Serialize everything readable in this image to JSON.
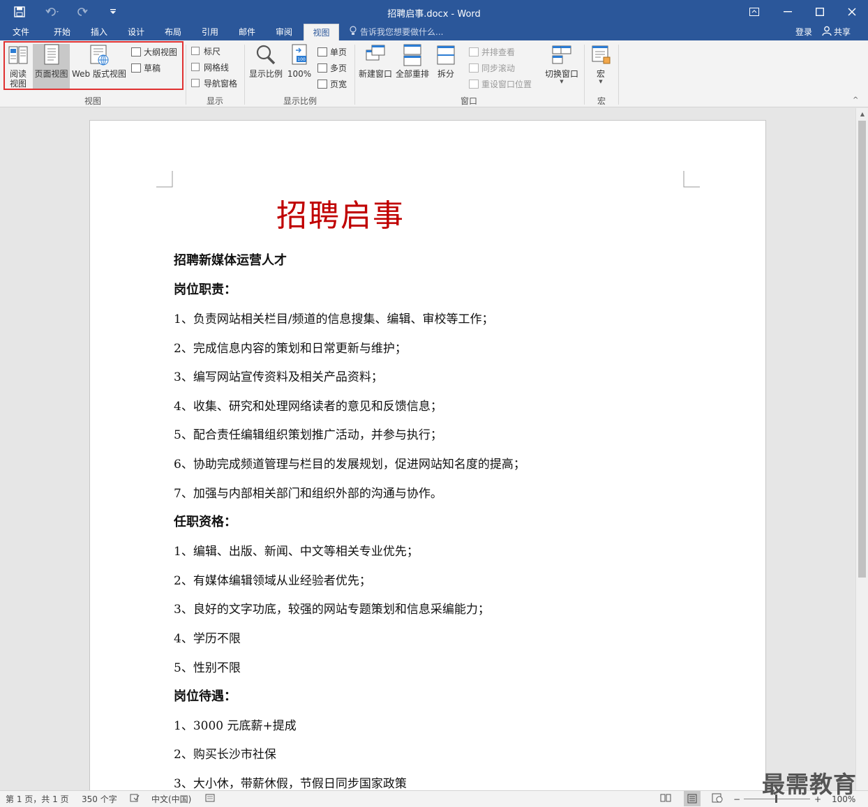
{
  "window": {
    "title": "招聘启事.docx - Word",
    "quick_access": [
      "save-icon",
      "undo-icon",
      "redo-icon",
      "customize-icon"
    ]
  },
  "tabs": [
    "文件",
    "开始",
    "插入",
    "设计",
    "布局",
    "引用",
    "邮件",
    "审阅",
    "视图"
  ],
  "active_tab": "视图",
  "tell_me": "告诉我您想要做什么...",
  "account": {
    "login": "登录",
    "share": "共享"
  },
  "ribbon": {
    "views": {
      "label": "视图",
      "read_mode": "阅读\n视图",
      "print_layout": "页面视图",
      "web_layout": "Web 版式视图",
      "outline": "大纲视图",
      "draft": "草稿"
    },
    "show": {
      "label": "显示",
      "ruler": "标尺",
      "gridlines": "网格线",
      "nav_pane": "导航窗格"
    },
    "zoom": {
      "label": "显示比例",
      "zoom": "显示比例",
      "hundred": "100%",
      "one_page": "单页",
      "multi_page": "多页",
      "page_width": "页宽"
    },
    "window": {
      "label": "窗口",
      "new_window": "新建窗口",
      "arrange_all": "全部重排",
      "split": "拆分",
      "side_by_side": "并排查看",
      "sync_scroll": "同步滚动",
      "reset_pos": "重设窗口位置",
      "switch": "切换窗口"
    },
    "macros": {
      "label": "宏",
      "macros": "宏"
    }
  },
  "document": {
    "title": "招聘启事",
    "paragraphs": [
      "招聘新媒体运营人才",
      "岗位职责：",
      "1、负责网站相关栏目/频道的信息搜集、编辑、审校等工作；",
      "2、完成信息内容的策划和日常更新与维护；",
      "3、编写网站宣传资料及相关产品资料；",
      "4、收集、研究和处理网络读者的意见和反馈信息；",
      "5、配合责任编辑组织策划推广活动，并参与执行；",
      "6、协助完成频道管理与栏目的发展规划，促进网站知名度的提高；",
      "7、加强与内部相关部门和组织外部的沟通与协作。",
      "任职资格：",
      "1、编辑、出版、新闻、中文等相关专业优先；",
      "2、有媒体编辑领域从业经验者优先；",
      "3、良好的文字功底，较强的网站专题策划和信息采编能力；",
      "4、学历不限",
      "5、性别不限",
      "岗位待遇：",
      "1、3000 元底薪+提成",
      "2、购买长沙市社保",
      "3、大小休，带薪休假，节假日同步国家政策"
    ]
  },
  "status": {
    "page": "第 1 页，共 1 页",
    "words": "350 个字",
    "lang": "中文(中国)",
    "zoom": "100%"
  },
  "watermark": "最需教育"
}
